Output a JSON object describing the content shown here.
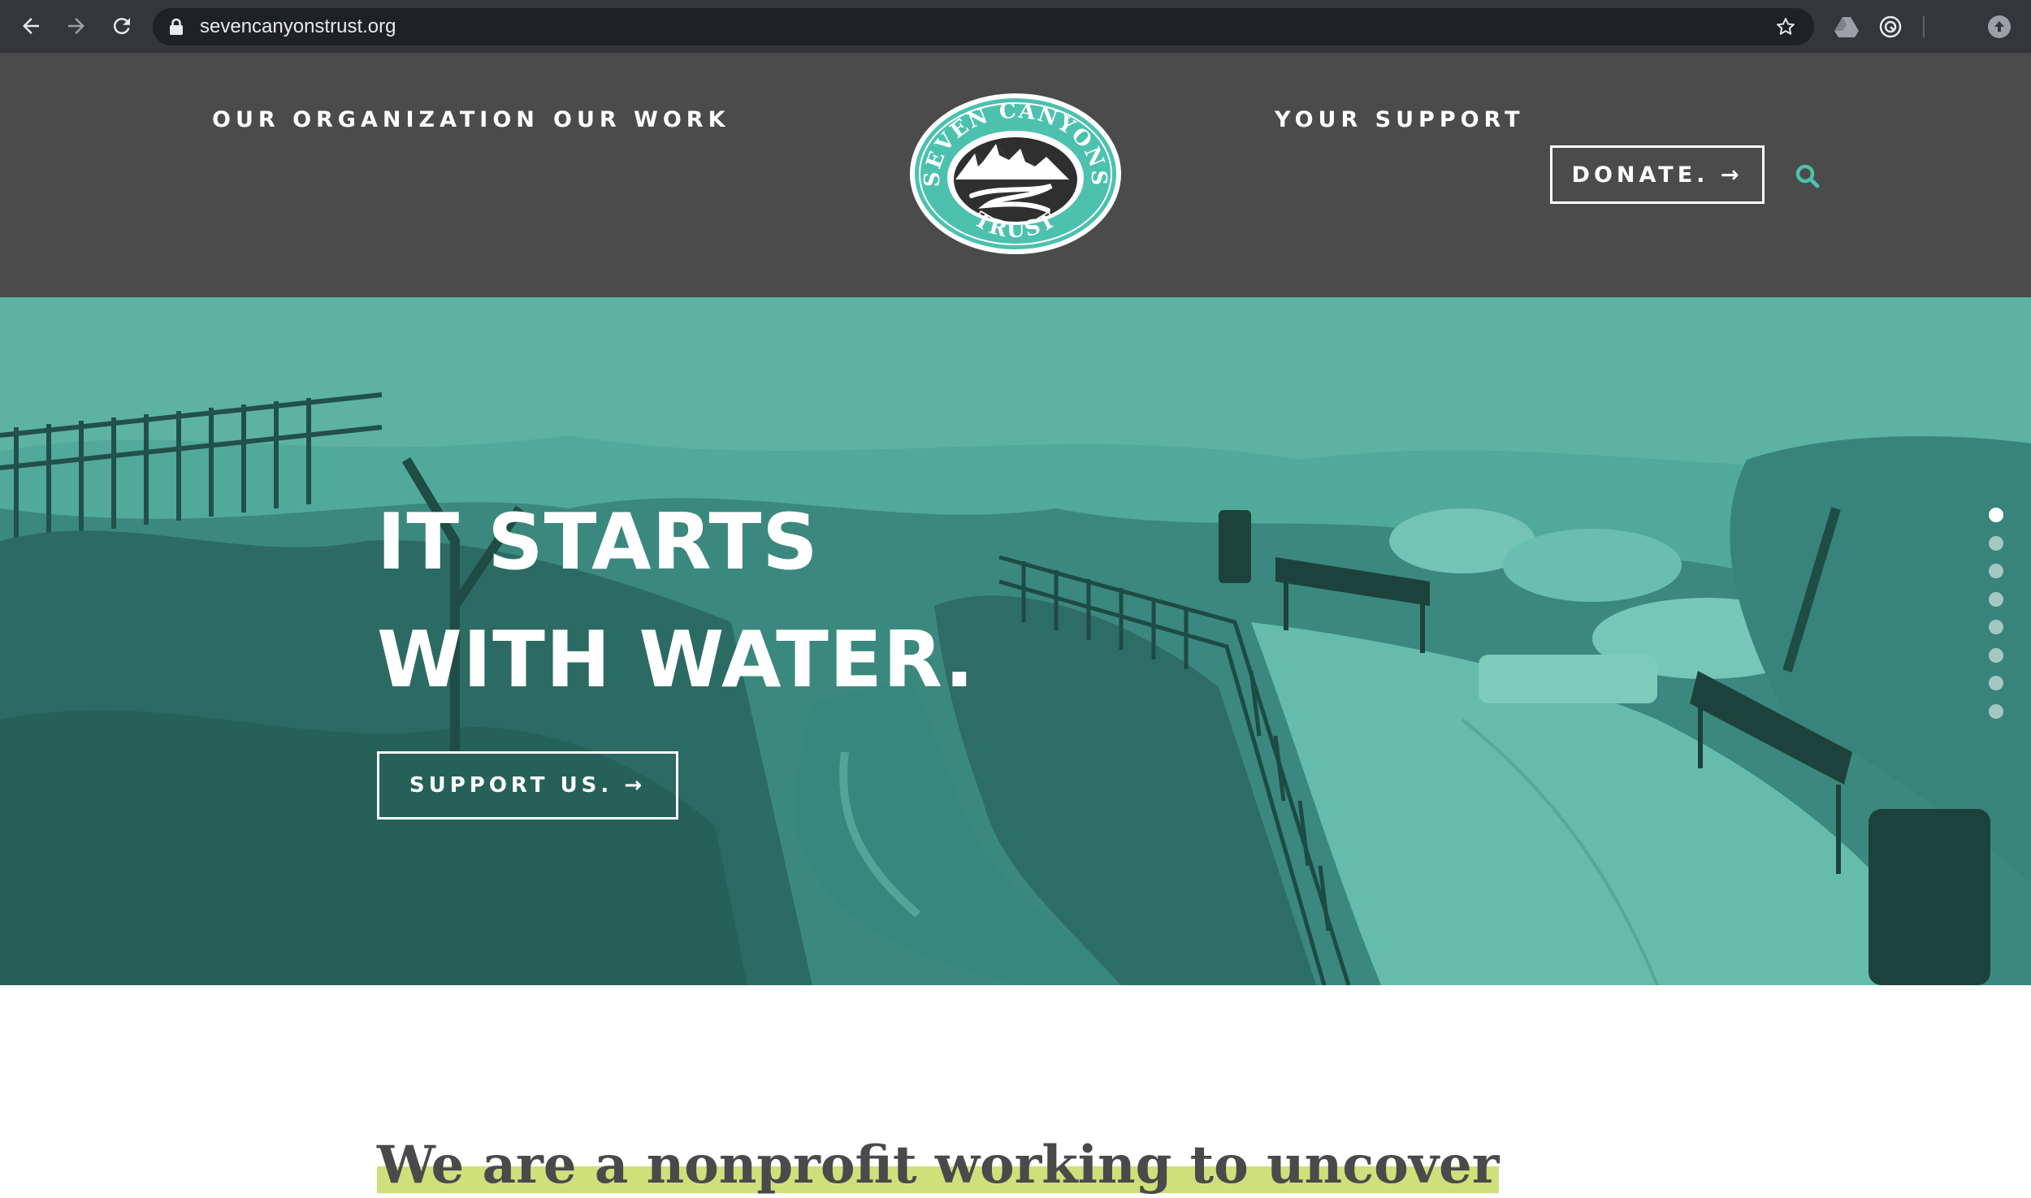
{
  "browser": {
    "url": "sevencanyonstrust.org",
    "icons": [
      "back-icon",
      "forward-icon",
      "reload-icon",
      "lock-icon",
      "star-icon",
      "drive-icon",
      "extension-icon",
      "profile-icon"
    ]
  },
  "header": {
    "nav_left": [
      "OUR ORGANIZATION",
      "OUR WORK"
    ],
    "nav_right": [
      "YOUR SUPPORT"
    ],
    "donate_label": "DONATE. →",
    "logo": {
      "top_text": "SEVEN CANYONS",
      "bottom_text": "TRUST"
    }
  },
  "hero": {
    "title_line1": "IT STARTS",
    "title_line2": "WITH WATER.",
    "cta_label": "SUPPORT US. →",
    "slides_count": 8,
    "active_slide": 1
  },
  "intro": {
    "heading": "We are a nonprofit working to uncover"
  },
  "colors": {
    "header_bg": "#4b4b4c",
    "accent_teal": "#4cc1ae",
    "highlight": "#cfe07a"
  }
}
